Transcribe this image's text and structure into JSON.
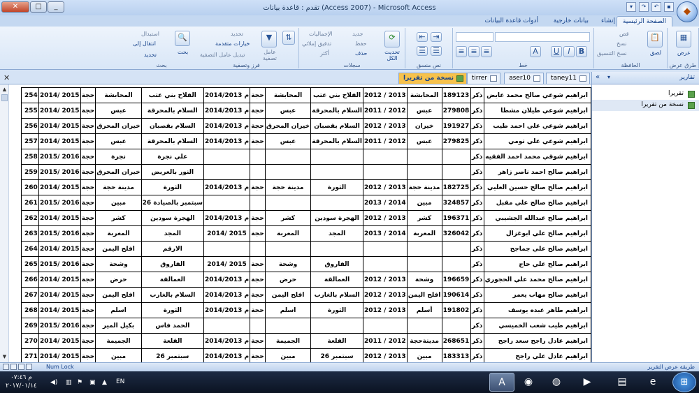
{
  "window": {
    "title": "تقدم : قاعدة بيانات (Access 2007) - Microsoft Access",
    "minimize": "_",
    "restore": "□",
    "close": "✕"
  },
  "tabs": [
    "الصفحة الرئيسية",
    "إنشاء",
    "بيانات خارجية",
    "أدوات قاعدة البيانات"
  ],
  "ribbon": {
    "groups": {
      "views": {
        "label": "طرق عرض",
        "button": "عرض"
      },
      "clipboard": {
        "label": "الحافظة",
        "paste": "لصق",
        "cut": "قص",
        "copy": "نسخ",
        "format_painter": "نسخ التنسيق"
      },
      "font": {
        "label": "خط",
        "bold": "B",
        "italic": "I",
        "underline": "U"
      },
      "rich_text": {
        "label": "نص منسق"
      },
      "records": {
        "label": "سجلات",
        "refresh": "تحديث الكل",
        "new": "جديد",
        "save": "حفظ",
        "delete": "حذف",
        "totals": "الإجماليات",
        "spelling": "تدقيق إملائي",
        "more": "أكثر"
      },
      "sort_filter": {
        "label": "فرز وتصفية",
        "filter": "عامل تصفية",
        "selection": "تحديد",
        "advanced": "خيارات متقدمة",
        "toggle_filter": "تبديل عامل التصفية"
      },
      "find": {
        "label": "بحث",
        "find": "بحث",
        "replace": "استبدال",
        "goto": "انتقال إلى",
        "select": "تحديد"
      }
    }
  },
  "nav": {
    "header": "تقارير",
    "items": [
      {
        "label": "تقريرا",
        "selected": false
      },
      {
        "label": "نسخة من تقريرا",
        "selected": true
      }
    ]
  },
  "doc_tabs": [
    {
      "label": "taney11",
      "active": false
    },
    {
      "label": "aser10",
      "active": false
    },
    {
      "label": "tirrer",
      "active": false
    },
    {
      "label": "نسخة من تقريرا",
      "active": true
    }
  ],
  "report": {
    "rows": [
      [
        "254",
        "2014/ 2015",
        "حجة",
        "المحابشة",
        "الفلاح بني عتب",
        "2014/2013 م",
        "حجة",
        "المحابشة",
        "الفلاح بني عتب",
        "2012 / 2013",
        "المحابشة",
        "189123",
        "ذكر",
        "ابراهيم شوعي صالح محمد عايض"
      ],
      [
        "255",
        "2014/ 2015",
        "حجة",
        "عبس",
        "السلام بالمحرقة",
        "2014/2013 م",
        "حجة",
        "عبس",
        "السلام بالمحرقة",
        "2011 / 2012",
        "عبس",
        "279808",
        "ذكر",
        "ابراهيم شوعي طيلان مشطا"
      ],
      [
        "256",
        "2014/ 2015",
        "حجة",
        "خيران المحرق",
        "السلام بقصبان",
        "2014/2013 م",
        "حجة",
        "خيران المحرق",
        "السلام بقصبان",
        "2012 / 2013",
        "خيران",
        "191927",
        "ذكر",
        "ابراهيم شوعي علي احمد طيب"
      ],
      [
        "257",
        "2014/ 2015",
        "حجة",
        "عبس",
        "السلام بالمحرقة",
        "2014/2013 م",
        "حجة",
        "عبس",
        "السلام بالمحرقة",
        "2011 / 2012",
        "عبس",
        "279825",
        "ذكر",
        "ابراهيم شوعي علي تومي"
      ],
      [
        "258",
        "2015/ 2016",
        "حجة",
        "نجرة",
        "علي نجرة",
        "",
        "",
        "",
        "",
        "",
        "",
        "",
        "ذكر",
        "ابراهيم شوقي محمد احمد الفقيه"
      ],
      [
        "259",
        "2015/ 2016",
        "حجة",
        "خيران المحرق",
        "النور بالعريض",
        "",
        "",
        "",
        "",
        "",
        "",
        "",
        "ذكر",
        "ابراهيم صالح احمد ناصر زاهر"
      ],
      [
        "260",
        "2014/ 2015",
        "حجة",
        "مدينة حجة",
        "الثورة",
        "2014/2013 م",
        "حجة",
        "مدينة حجة",
        "الثورة",
        "2012 / 2013",
        "مدينة حجة",
        "182725",
        "ذكر",
        "ابراهيم صالح صالح حسين العليي"
      ],
      [
        "261",
        "2015/ 2016",
        "حجة",
        "مبين",
        "26 سبتمبر بالصيادة",
        "",
        "",
        "",
        "",
        "2013 / 2014",
        "مبين",
        "324857",
        "ذكر",
        "ابراهيم صالح صالح علي مقبل"
      ],
      [
        "262",
        "2014/ 2015",
        "حجة",
        "كشر",
        "الهجرة سودين",
        "2014/2013 م",
        "حجة",
        "كشر",
        "الهجرة سودين",
        "2012 / 2013",
        "كشر",
        "196371",
        "ذكر",
        "ابراهيم صالح عبدالله الجشيبي"
      ],
      [
        "263",
        "2015/ 2016",
        "حجة",
        "المغربة",
        "المجد",
        "2014/ 2015",
        "حجة",
        "المغربة",
        "المجد",
        "2013 / 2014",
        "المغربة",
        "326042",
        "ذكر",
        "ابراهيم صالح علي ابوغزال"
      ],
      [
        "264",
        "2014/ 2015",
        "حجة",
        "افلح اليمن",
        "الارقم",
        "",
        "",
        "",
        "",
        "",
        "",
        "",
        "ذكر",
        "ابراهيم صالح علي جماجح"
      ],
      [
        "265",
        "2015/ 2016",
        "حجة",
        "وشحة",
        "الفاروق",
        "2014/ 2015",
        "حجة",
        "وشحة",
        "الفاروق",
        "",
        "",
        "",
        "ذكر",
        "ابراهيم صالح علي حاج"
      ],
      [
        "266",
        "2014/ 2015",
        "حجة",
        "حرض",
        "العمالقة",
        "2014/2013 م",
        "حجة",
        "حرض",
        "العمالقة",
        "2012 / 2013",
        "وشحة",
        "196659",
        "ذكر",
        "ابراهيم صالح محمد علي الحجوري"
      ],
      [
        "267",
        "2014/ 2015",
        "حجة",
        "افلح اليمن",
        "السلام بالغارب",
        "2014/2013 م",
        "حجة",
        "افلح اليمن",
        "السلام بالغارب",
        "2012 / 2013",
        "افلح اليمن",
        "190614",
        "ذكر",
        "ابراهيم صالح مهاب يعمر"
      ],
      [
        "268",
        "2014/ 2015",
        "حجة",
        "اسلم",
        "الثورة",
        "2014/2013 م",
        "حجة",
        "اسلم",
        "الثورة",
        "2012 / 2013",
        "أسلم",
        "191802",
        "ذكر",
        "ابراهيم طاهر عبده يوسف"
      ],
      [
        "269",
        "2015/ 2016",
        "حجة",
        "بكيل المير",
        "الحمد فاس",
        "",
        "",
        "",
        "",
        "",
        "",
        "",
        "ذكر",
        "ابراهيم طيب شعب الخميسي"
      ],
      [
        "270",
        "2014/ 2015",
        "حجة",
        "الجميمة",
        "القلعة",
        "2014/2013 م",
        "حجة",
        "الجميمة",
        "القلعة",
        "2011 / 2012",
        "مدينةحجة",
        "268651",
        "ذكر",
        "ابراهيم عادل راجح سعد راجح"
      ],
      [
        "271",
        "2014/ 2015",
        "حجة",
        "مبين",
        "26 سبتمبر",
        "2014/2013 م",
        "حجة",
        "مبين",
        "26 سبتمبر",
        "2012 / 2013",
        "مبين",
        "183313",
        "ذكر",
        "ابراهيم عادل علي راجح"
      ]
    ]
  },
  "status": {
    "left": "Num Lock",
    "right": "طريقة عرض التقرير"
  },
  "taskbar": {
    "lang": "EN",
    "time": "م ٠٧:٤٦",
    "date": "٢٠١٧/٠١/١٤"
  }
}
